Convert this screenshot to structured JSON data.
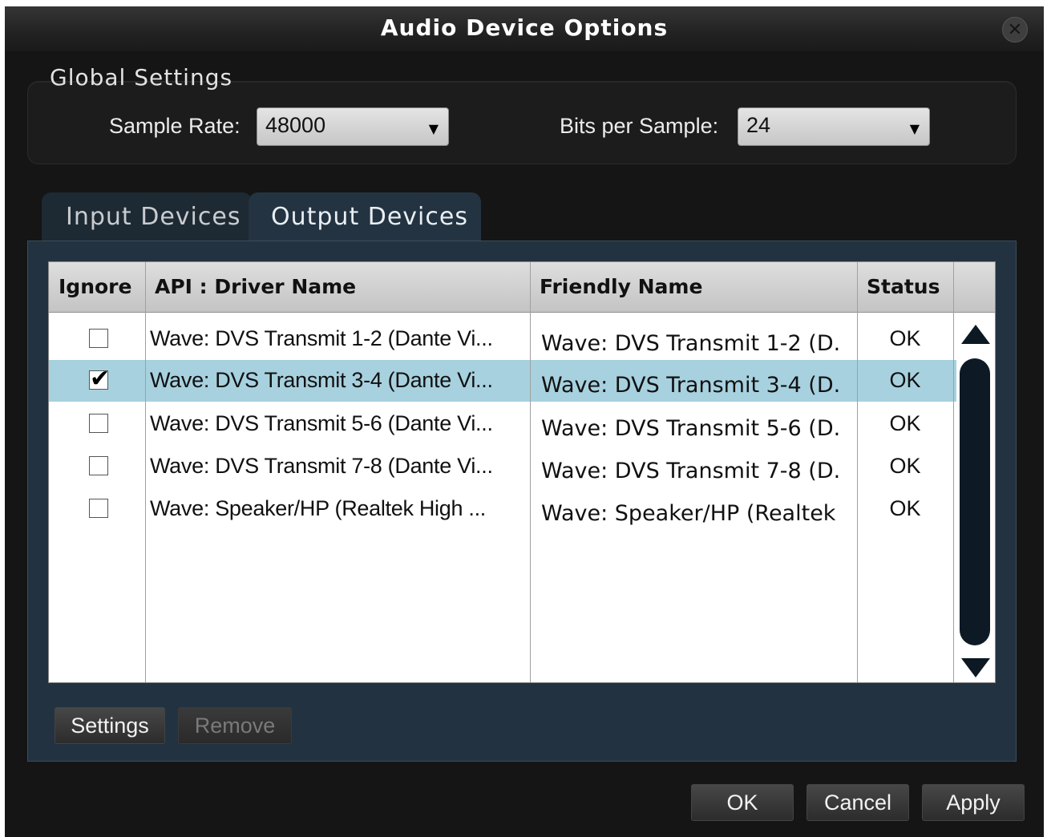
{
  "window": {
    "title": "Audio Device Options"
  },
  "global_settings": {
    "title": "Global Settings",
    "sample_rate": {
      "label": "Sample Rate:",
      "value": "48000"
    },
    "bits_per_sample": {
      "label": "Bits per Sample:",
      "value": "24"
    }
  },
  "tabs": [
    {
      "label": "Input Devices",
      "active": false
    },
    {
      "label": "Output Devices",
      "active": true
    }
  ],
  "table": {
    "columns": [
      "Ignore",
      "API : Driver Name",
      "Friendly Name",
      "Status"
    ],
    "rows": [
      {
        "ignore": false,
        "api": "Wave: DVS Transmit 1-2 (Dante Vi...",
        "friendly": "Wave: DVS Transmit 1-2 (D.",
        "status": "OK",
        "selected": false
      },
      {
        "ignore": true,
        "api": "Wave: DVS Transmit 3-4 (Dante Vi...",
        "friendly": "Wave: DVS Transmit 3-4 (D.",
        "status": "OK",
        "selected": true
      },
      {
        "ignore": false,
        "api": "Wave: DVS Transmit 5-6 (Dante Vi...",
        "friendly": "Wave: DVS Transmit 5-6 (D.",
        "status": "OK",
        "selected": false
      },
      {
        "ignore": false,
        "api": "Wave: DVS Transmit 7-8 (Dante Vi...",
        "friendly": "Wave: DVS Transmit 7-8 (D.",
        "status": "OK",
        "selected": false
      },
      {
        "ignore": false,
        "api": "Wave: Speaker/HP (Realtek High ...",
        "friendly": "Wave: Speaker/HP (Realtek",
        "status": "OK",
        "selected": false
      }
    ]
  },
  "panel_buttons": {
    "settings": "Settings",
    "remove": "Remove"
  },
  "dialog_buttons": {
    "ok": "OK",
    "cancel": "Cancel",
    "apply": "Apply"
  },
  "icons": {
    "close": "close-icon",
    "scroll_up": "arrow-up-icon",
    "scroll_down": "arrow-down-icon",
    "dropdown": "chevron-down-icon",
    "check": "checkmark-icon"
  },
  "colors": {
    "selected_row": "#a7d1df",
    "panel": "#223240",
    "window": "#151515"
  }
}
